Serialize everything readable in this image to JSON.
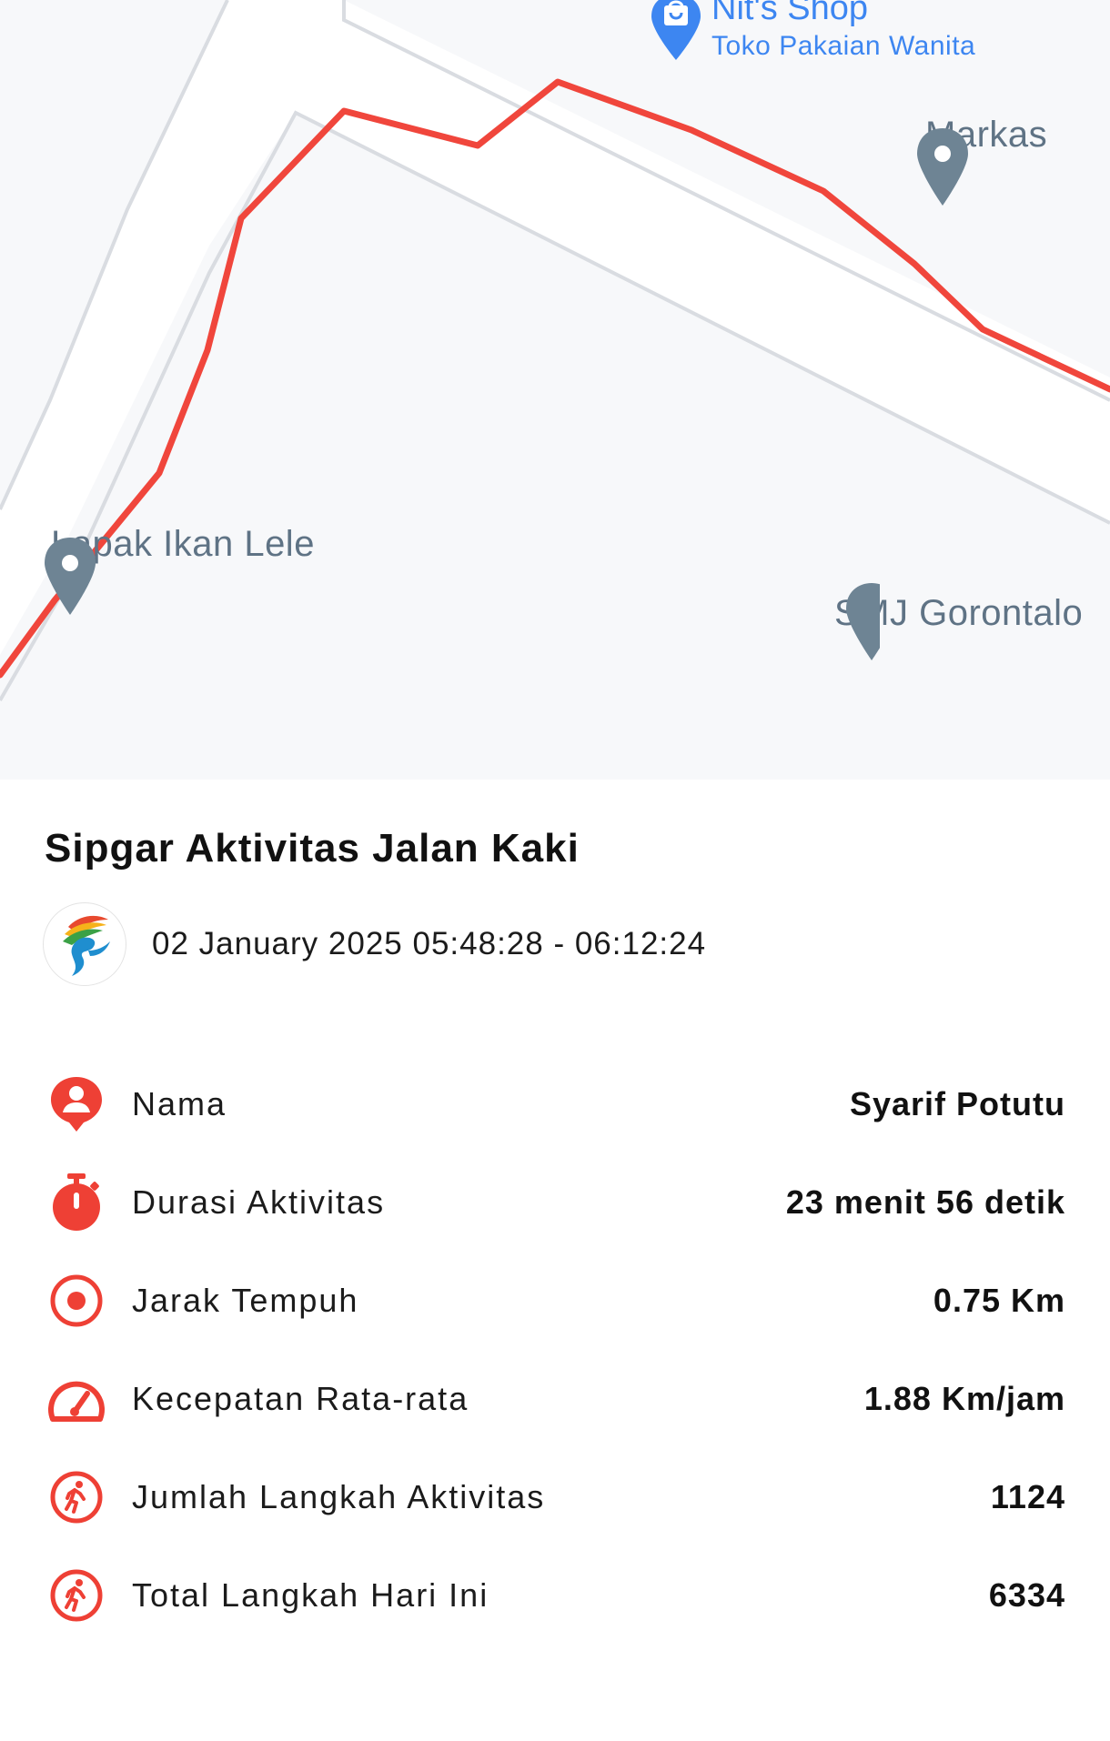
{
  "map": {
    "pois": {
      "shop_name": "Nit's Shop",
      "shop_category": "Toko Pakaian Wanita",
      "markas": "Markas",
      "lapak": "Lapak Ikan Lele",
      "smj": "SMJ Gorontalo"
    },
    "colors": {
      "route": "#f0463c",
      "road": "#ffffff",
      "road_edge": "#d8dbe0",
      "land": "#f7f8fa",
      "poi_pin": "#6e8494",
      "shop_pin": "#3d86f1"
    }
  },
  "activity": {
    "title": "Sipgar Aktivitas Jalan Kaki",
    "datetime": "02 January 2025 05:48:28 - 06:12:24",
    "logo_icon": "runner-logo-icon"
  },
  "stats": [
    {
      "icon": "person-pin-icon",
      "label": "Nama",
      "value": "Syarif Potutu"
    },
    {
      "icon": "stopwatch-icon",
      "label": "Durasi Aktivitas",
      "value": "23 menit 56 detik"
    },
    {
      "icon": "target-icon",
      "label": "Jarak Tempuh",
      "value": "0.75 Km"
    },
    {
      "icon": "speedometer-icon",
      "label": "Kecepatan Rata-rata",
      "value": "1.88 Km/jam"
    },
    {
      "icon": "walking-icon",
      "label": "Jumlah Langkah Aktivitas",
      "value": "1124"
    },
    {
      "icon": "walking-icon",
      "label": "Total Langkah Hari Ini",
      "value": "6334"
    }
  ],
  "accent_color": "#ee4035"
}
